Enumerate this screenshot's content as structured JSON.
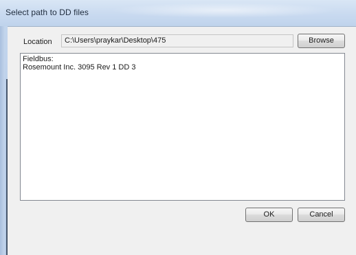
{
  "window": {
    "title": "Select path to DD files"
  },
  "location": {
    "label": "Location",
    "value": "C:\\Users\\praykar\\Desktop\\475",
    "browse_label": "Browse"
  },
  "content": {
    "lines": [
      "Fieldbus:",
      "Rosemount Inc. 3095 Rev 1 DD 3"
    ]
  },
  "buttons": {
    "ok_label": "OK",
    "cancel_label": "Cancel"
  }
}
